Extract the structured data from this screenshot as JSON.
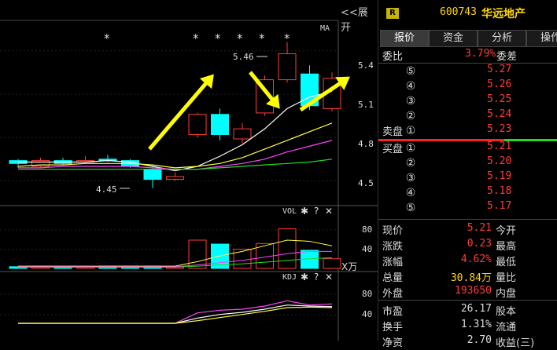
{
  "chart": {
    "expand_label": "<<展开",
    "ma_label": "MA",
    "price_ticks": [
      "5.4",
      "5.1",
      "4.8",
      "4.5"
    ],
    "high_label": "5.46",
    "low_label": "4.45",
    "vol_label": "VOL",
    "vol_ticks": [
      "80",
      "40"
    ],
    "vol_unit": "X万",
    "kdj_label": "KDJ",
    "kdj_ticks": [
      "80",
      "40"
    ],
    "star_glyph": "*",
    "gear_glyph": "✱",
    "help_glyph": "?",
    "close_glyph": "✕"
  },
  "chart_data": {
    "type": "candlestick",
    "candles": [
      {
        "open": 4.62,
        "close": 4.64,
        "high": 4.65,
        "low": 4.59,
        "color": "cyan",
        "volume": 3
      },
      {
        "open": 4.6,
        "close": 4.64,
        "high": 4.66,
        "low": 4.59,
        "color": "red",
        "volume": 4
      },
      {
        "open": 4.62,
        "close": 4.64,
        "high": 4.66,
        "low": 4.61,
        "color": "cyan",
        "volume": 3
      },
      {
        "open": 4.64,
        "close": 4.63,
        "high": 4.67,
        "low": 4.62,
        "color": "red",
        "volume": 3
      },
      {
        "open": 4.64,
        "close": 4.65,
        "high": 4.68,
        "low": 4.63,
        "color": "cyan",
        "volume": 4
      },
      {
        "open": 4.64,
        "close": 4.6,
        "high": 4.65,
        "low": 4.59,
        "color": "cyan",
        "volume": 4
      },
      {
        "open": 4.58,
        "close": 4.51,
        "high": 4.6,
        "low": 4.45,
        "color": "cyan",
        "volume": 4
      },
      {
        "open": 4.51,
        "close": 4.53,
        "high": 4.56,
        "low": 4.5,
        "color": "red",
        "volume": 3
      },
      {
        "open": 4.82,
        "close": 4.96,
        "high": 4.97,
        "low": 4.8,
        "color": "red",
        "volume": 50
      },
      {
        "open": 4.96,
        "close": 4.82,
        "high": 5.0,
        "low": 4.78,
        "color": "cyan",
        "volume": 43
      },
      {
        "open": 4.79,
        "close": 4.86,
        "high": 4.9,
        "low": 4.76,
        "color": "red",
        "volume": 34
      },
      {
        "open": 4.97,
        "close": 5.2,
        "high": 5.23,
        "low": 4.95,
        "color": "red",
        "volume": 44
      },
      {
        "open": 5.2,
        "close": 5.38,
        "high": 5.46,
        "low": 5.18,
        "color": "red",
        "volume": 70
      },
      {
        "open": 5.24,
        "close": 5.02,
        "high": 5.3,
        "low": 4.99,
        "color": "cyan",
        "volume": 32
      },
      {
        "open": 5.0,
        "close": 5.21,
        "high": 5.25,
        "low": 4.98,
        "color": "red",
        "volume": 17
      }
    ],
    "ylim": [
      4.35,
      5.6
    ],
    "ticks": [
      5.4,
      5.1,
      4.8,
      4.5
    ],
    "high": 5.46,
    "low": 4.45
  },
  "panel": {
    "badge": "R",
    "code": "600743",
    "name": "华远地产",
    "tabs": [
      "报价",
      "资金",
      "分析",
      "操作"
    ],
    "weibi_label": "委比",
    "weibi_value": "3.79%",
    "weicha_label": "委差",
    "sell_label": "卖盘",
    "buy_label": "买盘",
    "asks": [
      {
        "level": "⑤",
        "price": "5.27"
      },
      {
        "level": "④",
        "price": "5.26"
      },
      {
        "level": "③",
        "price": "5.25"
      },
      {
        "level": "②",
        "price": "5.24"
      },
      {
        "level": "①",
        "price": "5.23"
      }
    ],
    "bids": [
      {
        "level": "①",
        "price": "5.21"
      },
      {
        "level": "②",
        "price": "5.20"
      },
      {
        "level": "③",
        "price": "5.19"
      },
      {
        "level": "④",
        "price": "5.18"
      },
      {
        "level": "⑤",
        "price": "5.17"
      }
    ],
    "stats": [
      {
        "l1": "现价",
        "v1": "5.21",
        "l2": "今开",
        "c1": "red"
      },
      {
        "l1": "涨跌",
        "v1": "0.23",
        "l2": "最高",
        "c1": "red"
      },
      {
        "l1": "涨幅",
        "v1": "4.62%",
        "l2": "最低",
        "c1": "red"
      },
      {
        "l1": "总量",
        "v1": "30.84万",
        "l2": "量比",
        "c1": "yellow"
      },
      {
        "l1": "外盘",
        "v1": "193650",
        "l2": "内盘",
        "c1": "red"
      },
      {
        "l1": "市盈",
        "v1": "26.17",
        "l2": "股本",
        "c1": "white"
      },
      {
        "l1": "换手",
        "v1": "1.31%",
        "l2": "流通",
        "c1": "white"
      },
      {
        "l1": "净资",
        "v1": "2.70",
        "l2": "收益(三)",
        "c1": "white"
      }
    ]
  }
}
